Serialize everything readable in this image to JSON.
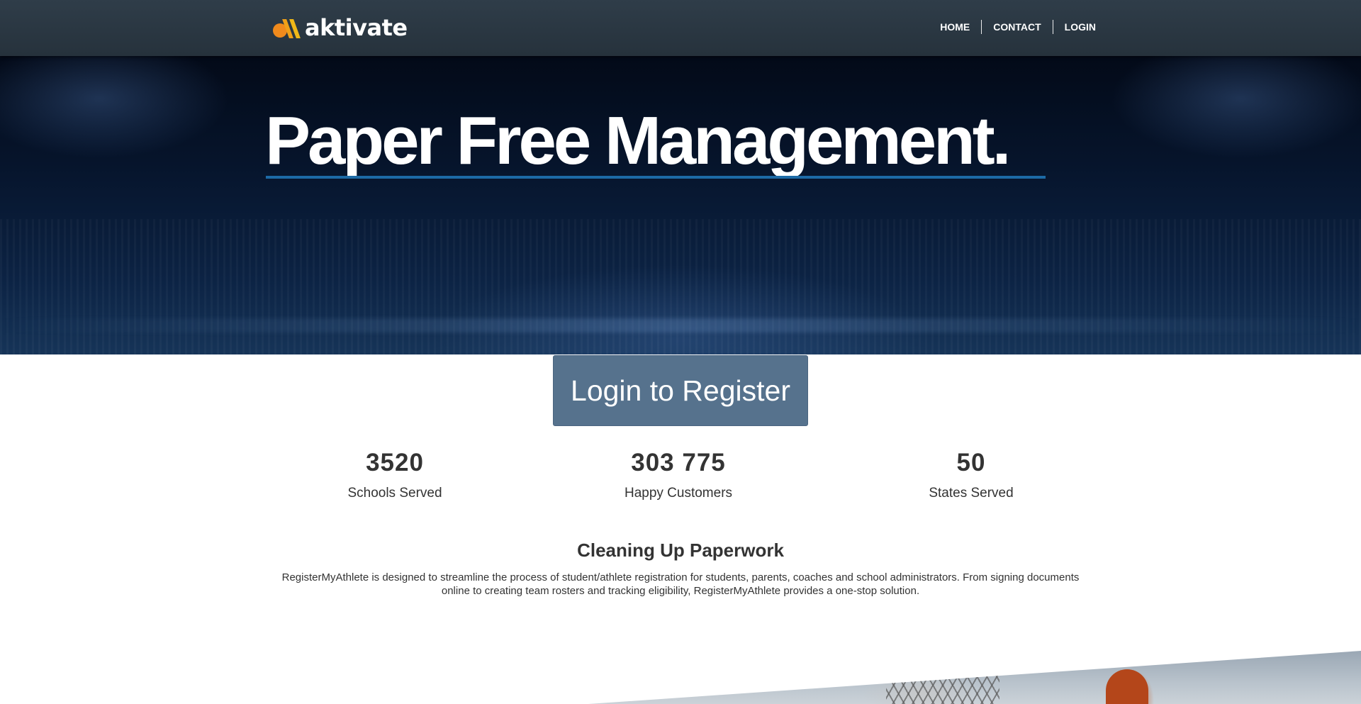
{
  "header": {
    "logo_text": "aktivate",
    "nav": [
      {
        "label": "HOME"
      },
      {
        "label": "CONTACT"
      },
      {
        "label": "LOGIN"
      }
    ]
  },
  "hero": {
    "title": "Paper Free Management."
  },
  "cta": {
    "label": "Login to Register"
  },
  "stats": [
    {
      "value": "3520",
      "label": "Schools Served"
    },
    {
      "value": "303 775",
      "label": "Happy Customers"
    },
    {
      "value": "50",
      "label": "States Served"
    }
  ],
  "section": {
    "title": "Cleaning Up Paperwork",
    "body": "RegisterMyAthlete is designed to streamline the process of student/athlete registration for students, parents, coaches and school administrators. From signing documents online to creating team rosters and tracking eligibility, RegisterMyAthlete provides a one-stop solution."
  },
  "colors": {
    "header_bg": "#2b3843",
    "accent_orange": "#f08a1c",
    "cta_bg": "#56728d",
    "hero_underline": "#1c6aa6"
  }
}
